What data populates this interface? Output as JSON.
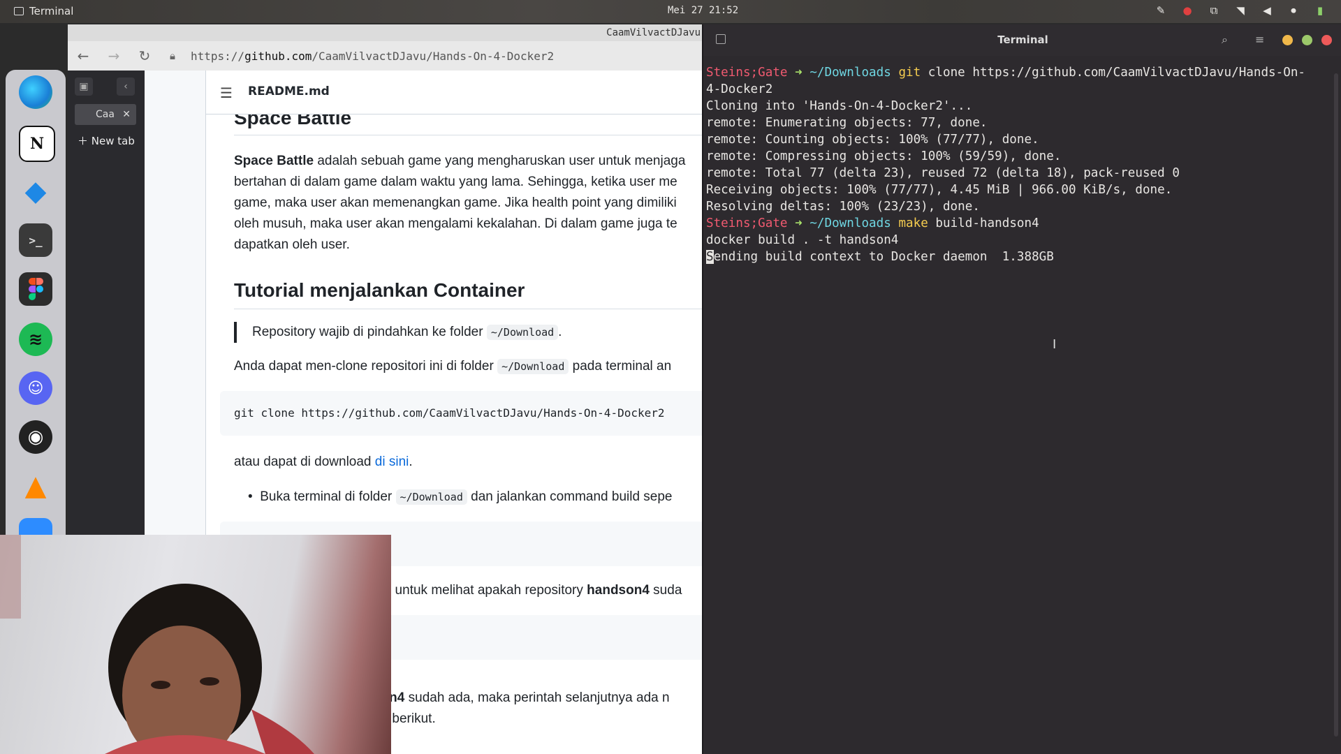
{
  "topbar": {
    "app_name": "Terminal",
    "clock": "Mei 27 21:52"
  },
  "browser": {
    "window_title": "CaamVilvactDJavu",
    "url_prefix": "https://",
    "url_domain": "github.com",
    "url_path": "/CaamVilvactDJavu/Hands-On-4-Docker2",
    "side_tab_label": "Caa",
    "new_tab_label": "New tab",
    "readme_filename": "README.md",
    "content": {
      "partial_heading": "Space Battle",
      "intro_bold": "Space Battle",
      "intro_rest": " adalah sebuah game yang mengharuskan user untuk menjaga ",
      "intro_line2": "bertahan di dalam game dalam waktu yang lama. Sehingga, ketika user me",
      "intro_line3": "game, maka user akan memenangkan game. Jika health point yang dimiliki",
      "intro_line4": "oleh musuh, maka user akan mengalami kekalahan. Di dalam game juga te",
      "intro_line5": "dapatkan oleh user.",
      "tutorial_heading": "Tutorial menjalankan Container",
      "quote_text": "Repository wajib di pindahkan ke folder ",
      "quote_code": "~/Download",
      "quote_end": ".",
      "clone_text": "Anda dapat men-clone repositori ini di folder ",
      "clone_code": "~/Download",
      "clone_rest": " pada terminal an",
      "codeblock_1": "git clone https://github.com/CaamVilvactDJavu/Hands-On-4-Docker2",
      "download_text": "atau dapat di download ",
      "download_link": "di sini",
      "download_end": ".",
      "bullet_text": "Buka terminal di folder ",
      "bullet_code": "~/Download",
      "bullet_rest": " dan jalankan command build sepe",
      "check_text": ", untuk melihat apakah repository ",
      "check_bold": "handson4",
      "check_rest": " suda",
      "exists_bold": "son4",
      "exists_rest": " sudah ada, maka perintah selanjutnya ada n",
      "exists_line2": "ah berikut."
    }
  },
  "terminal": {
    "title": "Terminal",
    "lines": [
      {
        "prompt_user": "Steins;Gate",
        "prompt_arrow": "➜",
        "prompt_dir": "~/Downloads",
        "cmd": "git",
        "args": " clone https://github.com/CaamVilvactDJavu/Hands-On-"
      },
      {
        "text": "4-Docker2"
      },
      {
        "text": "Cloning into 'Hands-On-4-Docker2'..."
      },
      {
        "text": "remote: Enumerating objects: 77, done."
      },
      {
        "text": "remote: Counting objects: 100% (77/77), done."
      },
      {
        "text": "remote: Compressing objects: 100% (59/59), done."
      },
      {
        "text": "remote: Total 77 (delta 23), reused 72 (delta 18), pack-reused 0"
      },
      {
        "text": "Receiving objects: 100% (77/77), 4.45 MiB | 966.00 KiB/s, done."
      },
      {
        "text": "Resolving deltas: 100% (23/23), done."
      },
      {
        "prompt_user": "Steins;Gate",
        "prompt_arrow": "➜",
        "prompt_dir": "~/Downloads",
        "cmd": "make",
        "args": " build-handson4"
      },
      {
        "text": "docker build . -t handson4"
      },
      {
        "cursor_char": "S",
        "text": "ending build context to Docker daemon  1.388GB"
      }
    ]
  },
  "dock": {
    "items": [
      "edge",
      "notion",
      "vscode",
      "terminal",
      "figma",
      "spotify",
      "discord",
      "obs",
      "vlc",
      "zoom"
    ]
  },
  "colors": {
    "prompt_user": "#f05a70",
    "prompt_arrow": "#a8e06a",
    "prompt_dir": "#6fd6e2",
    "command": "#f5cc4f",
    "terminal_bg": "#2d2a2e",
    "link": "#0969da"
  }
}
